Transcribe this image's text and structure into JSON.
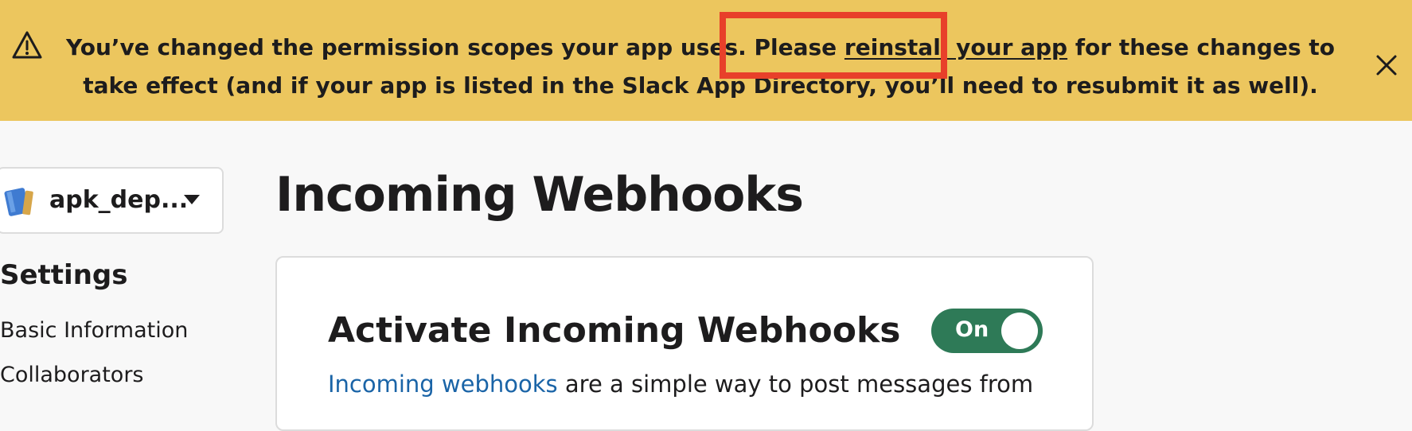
{
  "banner": {
    "text_before": "You’ve changed the permission scopes your app uses. Please ",
    "link_text": "reinstall your app",
    "text_after": " for these changes to take effect (and if your app is listed in the Slack App Directory, you’ll need to resubmit it as well).",
    "icons": {
      "warning": "warning-triangle-icon",
      "close": "close-x-icon"
    },
    "colors": {
      "background": "#ecc65e",
      "highlight": "#e8402a"
    }
  },
  "sidebar": {
    "app_name": "apk_dep...",
    "settings_heading": "Settings",
    "items": [
      {
        "label": "Basic Information"
      },
      {
        "label": "Collaborators"
      }
    ]
  },
  "main": {
    "page_title": "Incoming Webhooks",
    "card": {
      "title": "Activate Incoming Webhooks",
      "toggle_label": "On",
      "toggle_on": true,
      "desc_link": "Incoming webhooks",
      "desc_text": " are a simple way to post messages from"
    }
  },
  "colors": {
    "toggle": "#2e7a57",
    "link": "#1a64a7"
  }
}
